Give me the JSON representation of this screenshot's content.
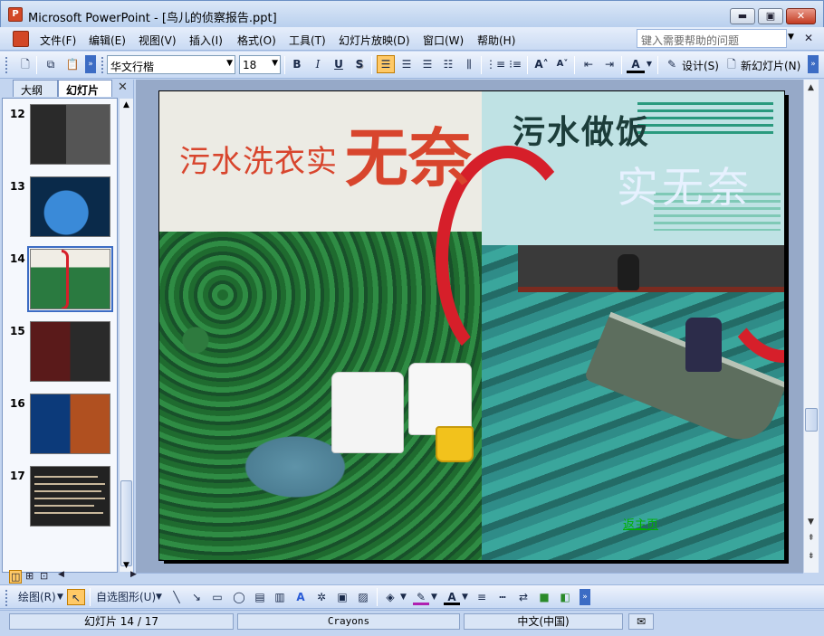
{
  "window": {
    "title": "Microsoft PowerPoint - [鸟儿的侦察报告.ppt]",
    "minimize": "▬",
    "maximize": "▣",
    "close": "✕",
    "app_icon": "P"
  },
  "menu": {
    "items": [
      "文件(F)",
      "编辑(E)",
      "视图(V)",
      "插入(I)",
      "格式(O)",
      "工具(T)",
      "幻灯片放映(D)",
      "窗口(W)",
      "帮助(H)"
    ],
    "help_placeholder": "键入需要帮助的问题"
  },
  "format_toolbar": {
    "font_name": "华文行楷",
    "font_size": "18",
    "bold": "B",
    "italic": "I",
    "underline": "U",
    "shadow": "S",
    "design_label": "设计(S)",
    "new_slide_label": "新幻灯片(N)"
  },
  "outline_pane": {
    "tabs": [
      "大纲",
      "幻灯片"
    ],
    "close": "✕",
    "thumbnails": [
      {
        "number": "12",
        "style": "t12"
      },
      {
        "number": "13",
        "style": "t13"
      },
      {
        "number": "14",
        "style": "t14",
        "selected": true
      },
      {
        "number": "15",
        "style": "t15"
      },
      {
        "number": "16",
        "style": "t16"
      },
      {
        "number": "17",
        "style": "t17"
      }
    ]
  },
  "slide": {
    "left_title": "污水洗衣实",
    "left_title_big": "无奈",
    "right_title": "污水做饭",
    "right_subtitle": "实无奈",
    "back_link": "返主页"
  },
  "drawing_toolbar": {
    "draw_label": "绘图(R)",
    "autoshapes_label": "自选图形(U)"
  },
  "status": {
    "slide_position": "幻灯片 14 / 17",
    "design_template": "Crayons",
    "language": "中文(中国)"
  },
  "colors": {
    "accent": "#3c6cc4",
    "title_red": "#d8452d",
    "ring_red": "#d61f2a",
    "link_green": "#00b000"
  }
}
